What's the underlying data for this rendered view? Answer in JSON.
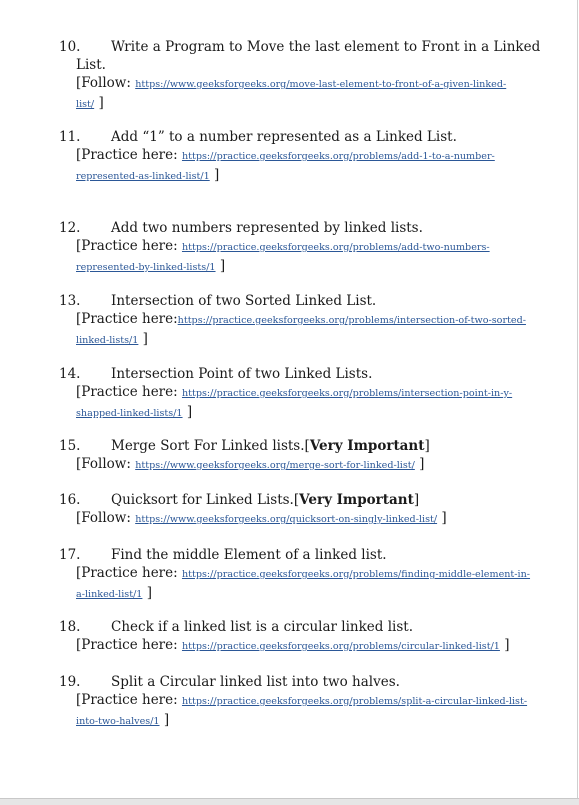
{
  "items": [
    {
      "number": "10.",
      "title_line1": "Write a Program to Move the last element to Front in a Linked",
      "title_line2": "List.",
      "ref_label": "[Follow: ",
      "link_line1": "https://www.geeksforgeeks.org/move-last-element-to-front-of-a-given-linked-",
      "link_line2": "list/",
      "close": " ]"
    },
    {
      "number": "11.",
      "title": "Add “1” to a number represented as a Linked List.",
      "ref_label": "[Practice here: ",
      "link_line1": "https://practice.geeksforgeeks.org/problems/add-1-to-a-number-",
      "link_line2": "represented-as-linked-list/1",
      "close": " ]"
    },
    {
      "number": "12.",
      "title": "Add two numbers represented by linked lists.",
      "ref_label": "[Practice here: ",
      "link_line1": "https://practice.geeksforgeeks.org/problems/add-two-numbers-",
      "link_line2": "represented-by-linked-lists/1",
      "close": " ]"
    },
    {
      "number": "13.",
      "title": "Intersection of two Sorted Linked List.",
      "ref_label": "[Practice here:",
      "link_line1": "https://practice.geeksforgeeks.org/problems/intersection-of-two-sorted-",
      "link_line2": "linked-lists/1",
      "close": " ]"
    },
    {
      "number": "14.",
      "title": "Intersection Point of two Linked Lists.",
      "ref_label": "[Practice here: ",
      "link_line1": "https://practice.geeksforgeeks.org/problems/intersection-point-in-y-",
      "link_line2": "shapped-linked-lists/1",
      "close": " ]"
    },
    {
      "number": "15.",
      "title": "Merge Sort For Linked lists.",
      "emphasis_open": "[",
      "emphasis": "Very Important",
      "emphasis_close": "]",
      "ref_label": "[Follow:  ",
      "link_line1": "https://www.geeksforgeeks.org/merge-sort-for-linked-list/",
      "close": " ]"
    },
    {
      "number": "16.",
      "title": "Quicksort for Linked Lists.",
      "emphasis_open": "[",
      "emphasis": "Very Important",
      "emphasis_close": "]",
      "ref_label": "[Follow: ",
      "link_line1": "https://www.geeksforgeeks.org/quicksort-on-singly-linked-list/",
      "close": " ]"
    },
    {
      "number": "17.",
      "title": "Find the middle Element of a linked list.",
      "ref_label": "[Practice here: ",
      "link_line1": "https://practice.geeksforgeeks.org/problems/finding-middle-element-in-",
      "link_line2": "a-linked-list/1",
      "close": " ]"
    },
    {
      "number": "18.",
      "title": "Check if a linked list is a circular linked list.",
      "ref_label": "[Practice here: ",
      "link_line1": "https://practice.geeksforgeeks.org/problems/circular-linked-list/1",
      "close": " ]"
    },
    {
      "number": "19.",
      "title": "Split a Circular linked list into two halves.",
      "ref_label": "[Practice here: ",
      "link_line1": "https://practice.geeksforgeeks.org/problems/split-a-circular-linked-list-",
      "link_line2": "into-two-halves/1",
      "close": " ]"
    }
  ]
}
